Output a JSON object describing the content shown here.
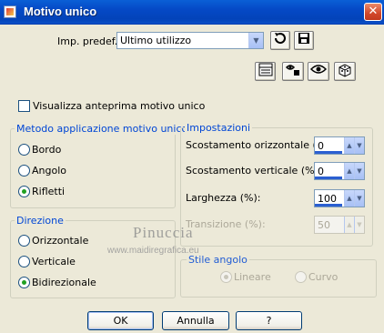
{
  "window": {
    "title": "Motivo unico",
    "close_glyph": "✕"
  },
  "preset": {
    "label": "Imp. predef.:",
    "selected": "Ultimo utilizzo",
    "icons": [
      "reset-icon",
      "save-icon"
    ]
  },
  "toolbar_icons": [
    "layout-icon",
    "randomize-icon",
    "preview-icon",
    "dice-icon"
  ],
  "preview_checkbox": {
    "label": "Visualizza anteprima motivo unico",
    "checked": false
  },
  "method_group": {
    "title": "Metodo applicazione motivo unico",
    "options": [
      {
        "label": "Bordo",
        "checked": false
      },
      {
        "label": "Angolo",
        "checked": false
      },
      {
        "label": "Rifletti",
        "checked": true
      }
    ]
  },
  "direction_group": {
    "title": "Direzione",
    "options": [
      {
        "label": "Orizzontale",
        "checked": false
      },
      {
        "label": "Verticale",
        "checked": false
      },
      {
        "label": "Bidirezionale",
        "checked": true
      }
    ]
  },
  "settings_group": {
    "title": "Impostazioni",
    "fields": [
      {
        "label": "Scostamento orizzontale (%):",
        "value": "0",
        "enabled": true
      },
      {
        "label": "Scostamento verticale (%):",
        "value": "0",
        "enabled": true
      },
      {
        "label": "Larghezza (%):",
        "value": "100",
        "enabled": true
      },
      {
        "label": "Transizione (%):",
        "value": "50",
        "enabled": false
      }
    ]
  },
  "corner_group": {
    "title": "Stile angolo",
    "options": [
      {
        "label": "Lineare",
        "checked": true,
        "enabled": false
      },
      {
        "label": "Curvo",
        "checked": false,
        "enabled": false
      }
    ]
  },
  "watermark": {
    "title": "Pinuccia",
    "url": "www.maidiregrafica.eu"
  },
  "buttons": {
    "ok": "OK",
    "cancel": "Annulla",
    "help": "?"
  },
  "colors": {
    "titlebar": "#0549c6",
    "group_title": "#0046d5",
    "radio_checked": "#21a121",
    "background": "#ece9d8"
  }
}
